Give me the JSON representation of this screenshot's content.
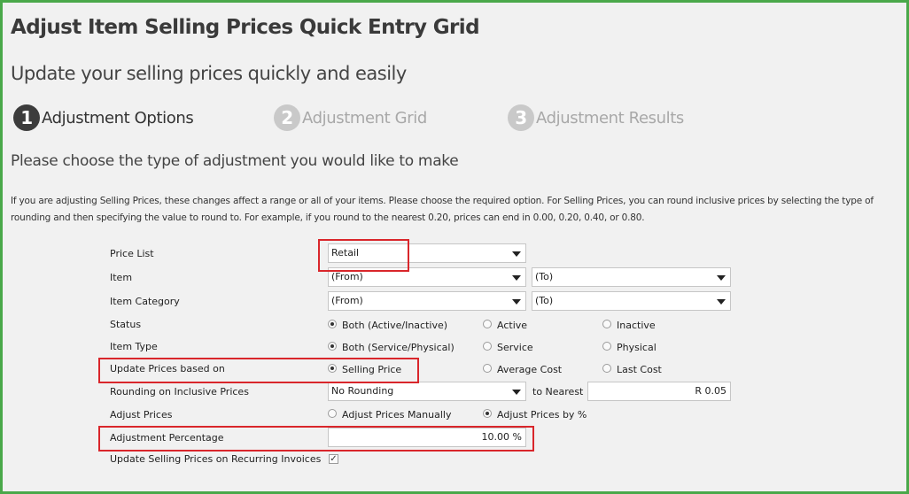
{
  "page": {
    "title": "Adjust Item Selling Prices Quick Entry Grid",
    "subtitle": "Update your selling prices quickly and easily",
    "steps": [
      {
        "num": "1",
        "label": "Adjustment Options"
      },
      {
        "num": "2",
        "label": "Adjustment Grid"
      },
      {
        "num": "3",
        "label": "Adjustment Results"
      }
    ],
    "prompt": "Please choose the type of adjustment you would like to make",
    "description": "If you are adjusting Selling Prices, these changes affect a range or all of your items. Please choose the required option. For Selling Prices, you can round inclusive prices by selecting the type of rounding and then specifying the value to round to. For example, if you round to the nearest 0.20, prices can end in 0.00, 0.20, 0.40, or 0.80."
  },
  "form": {
    "price_list": {
      "label": "Price List",
      "value": "Retail"
    },
    "item": {
      "label": "Item",
      "from": "(From)",
      "to": "(To)"
    },
    "item_category": {
      "label": "Item Category",
      "from": "(From)",
      "to": "(To)"
    },
    "status": {
      "label": "Status",
      "options": [
        "Both (Active/Inactive)",
        "Active",
        "Inactive"
      ],
      "selected": 0
    },
    "item_type": {
      "label": "Item Type",
      "options": [
        "Both (Service/Physical)",
        "Service",
        "Physical"
      ],
      "selected": 0
    },
    "update_based_on": {
      "label": "Update Prices based on",
      "options": [
        "Selling Price",
        "Average Cost",
        "Last Cost"
      ],
      "selected": 0
    },
    "rounding": {
      "label": "Rounding on Inclusive Prices",
      "value": "No Rounding",
      "to_nearest_label": "to Nearest",
      "to_nearest_value": "R 0.05"
    },
    "adjust_prices": {
      "label": "Adjust Prices",
      "options": [
        "Adjust Prices Manually",
        "Adjust Prices by %"
      ],
      "selected": 1
    },
    "adjustment_percentage": {
      "label": "Adjustment Percentage",
      "value": "10.00 %"
    },
    "recurring": {
      "label": "Update Selling Prices on Recurring Invoices",
      "checked": true
    }
  },
  "colors": {
    "border_green": "#4aa84a",
    "highlight_red": "#d9262b"
  },
  "icons": {
    "dropdown": "chevron-down-icon",
    "checkbox": "checkmark-icon"
  }
}
